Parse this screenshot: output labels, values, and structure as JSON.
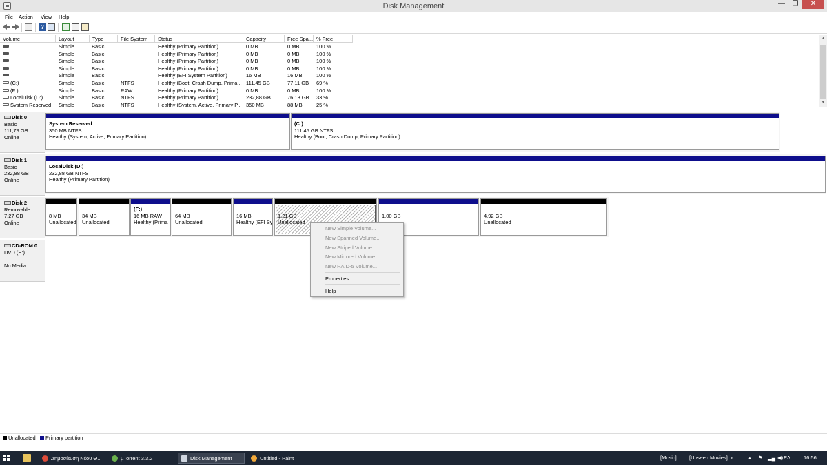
{
  "window": {
    "title": "Disk Management"
  },
  "menu": [
    "File",
    "Action",
    "View",
    "Help"
  ],
  "toolbar": [
    "back-icon",
    "forward-icon",
    "view-icon",
    "help-icon",
    "properties-icon",
    "refresh-icon",
    "rescan-icon",
    "settings-icon"
  ],
  "volume_list": {
    "columns": [
      "Volume",
      "Layout",
      "Type",
      "File System",
      "Status",
      "Capacity",
      "Free Spa...",
      "% Free"
    ],
    "rows": [
      [
        "",
        "Simple",
        "Basic",
        "",
        "Healthy (Primary Partition)",
        "0 MB",
        "0 MB",
        "100 %"
      ],
      [
        "",
        "Simple",
        "Basic",
        "",
        "Healthy (Primary Partition)",
        "0 MB",
        "0 MB",
        "100 %"
      ],
      [
        "",
        "Simple",
        "Basic",
        "",
        "Healthy (Primary Partition)",
        "0 MB",
        "0 MB",
        "100 %"
      ],
      [
        "",
        "Simple",
        "Basic",
        "",
        "Healthy (Primary Partition)",
        "0 MB",
        "0 MB",
        "100 %"
      ],
      [
        "",
        "Simple",
        "Basic",
        "",
        "Healthy (EFI System Partition)",
        "16 MB",
        "16 MB",
        "100 %"
      ],
      [
        "(C:)",
        "Simple",
        "Basic",
        "NTFS",
        "Healthy (Boot, Crash Dump, Prima...",
        "111,45 GB",
        "77,11 GB",
        "69 %"
      ],
      [
        "(F:)",
        "Simple",
        "Basic",
        "RAW",
        "Healthy (Primary Partition)",
        "0 MB",
        "0 MB",
        "100 %"
      ],
      [
        "LocalDisk (D:)",
        "Simple",
        "Basic",
        "NTFS",
        "Healthy (Primary Partition)",
        "232,88 GB",
        "76,13 GB",
        "33 %"
      ],
      [
        "System Reserved",
        "Simple",
        "Basic",
        "NTFS",
        "Healthy (System, Active, Primary P...",
        "350 MB",
        "88 MB",
        "25 %"
      ]
    ]
  },
  "disks": [
    {
      "name": "Disk 0",
      "info": [
        "Basic",
        "111,79 GB",
        "Online"
      ],
      "partitions": [
        {
          "title": "System Reserved",
          "size": "350 MB NTFS",
          "status": "Healthy (System, Active, Primary Partition)",
          "kind": "primary"
        },
        {
          "title": "(C:)",
          "size": "111,45 GB NTFS",
          "status": "Healthy (Boot, Crash Dump, Primary Partition)",
          "kind": "primary"
        }
      ]
    },
    {
      "name": "Disk 1",
      "info": [
        "Basic",
        "232,88 GB",
        "Online"
      ],
      "partitions": [
        {
          "title": "LocalDisk  (D:)",
          "size": "232,88 GB NTFS",
          "status": "Healthy (Primary Partition)",
          "kind": "primary"
        }
      ]
    },
    {
      "name": "Disk 2",
      "info": [
        "Removable",
        "7,27 GB",
        "Online"
      ],
      "partitions": [
        {
          "title": "",
          "size": "8 MB",
          "status": "Unallocated",
          "kind": "unallocated"
        },
        {
          "title": "",
          "size": "34 MB",
          "status": "Unallocated",
          "kind": "unallocated"
        },
        {
          "title": "(F:)",
          "size": "16 MB RAW",
          "status": "Healthy (Prima",
          "kind": "primary"
        },
        {
          "title": "",
          "size": "64 MB",
          "status": "Unallocated",
          "kind": "unallocated"
        },
        {
          "title": "",
          "size": "16 MB",
          "status": "Healthy (EFI Sy",
          "kind": "primary"
        },
        {
          "title": "",
          "size": "1,21 GB",
          "status": "Unallocated",
          "kind": "unallocated",
          "selected": true
        },
        {
          "title": "",
          "size": "1,00 GB",
          "status": "",
          "kind": "primary"
        },
        {
          "title": "",
          "size": "4,92 GB",
          "status": "Unallocated",
          "kind": "unallocated"
        }
      ]
    },
    {
      "name": "CD-ROM 0",
      "info": [
        "DVD (E:)",
        "",
        "No Media"
      ],
      "partitions": []
    }
  ],
  "context_menu": {
    "items": [
      {
        "label": "New Simple Volume...",
        "enabled": false
      },
      {
        "label": "New Spanned Volume...",
        "enabled": false
      },
      {
        "label": "New Striped Volume...",
        "enabled": false
      },
      {
        "label": "New Mirrored Volume...",
        "enabled": false
      },
      {
        "label": "New RAID-5 Volume...",
        "enabled": false
      },
      {
        "label": "Properties",
        "enabled": true
      },
      {
        "label": "Help",
        "enabled": true
      }
    ]
  },
  "legend": [
    {
      "label": "Unallocated",
      "color": "#000000"
    },
    {
      "label": "Primary partition",
      "color": "#0e0e8c"
    }
  ],
  "taskbar": {
    "tasks": [
      {
        "label": "Δημοσίευση Νέου Θ...",
        "icon": "chrome-icon",
        "active": false
      },
      {
        "label": "µTorrent 3.3.2",
        "icon": "utorrent-icon",
        "active": false
      },
      {
        "label": "Disk Management",
        "icon": "disk-management-icon",
        "active": true
      },
      {
        "label": "Untitled - Paint",
        "icon": "paint-icon",
        "active": false
      }
    ],
    "toolbars": [
      "[Music]",
      "[Unseen Movies]"
    ],
    "language": "ΕΛ",
    "clock": "16:56"
  }
}
